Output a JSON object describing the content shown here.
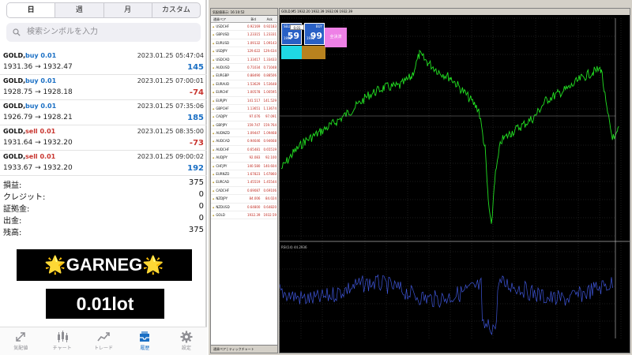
{
  "period_tabs": [
    "日",
    "週",
    "月",
    "カスタム"
  ],
  "search": {
    "placeholder": "検索シンボルを入力"
  },
  "trades": [
    {
      "symbol": "GOLD,",
      "side": "buy 0.01",
      "time": "2023.01.25 05:47:04",
      "prices": "1931.36 → 1932.47",
      "profit": "145"
    },
    {
      "symbol": "GOLD,",
      "side": "buy 0.01",
      "time": "2023.01.25 07:00:01",
      "prices": "1928.75 → 1928.18",
      "profit": "-74"
    },
    {
      "symbol": "GOLD,",
      "side": "buy 0.01",
      "time": "2023.01.25 07:35:06",
      "prices": "1926.79 → 1928.21",
      "profit": "185"
    },
    {
      "symbol": "GOLD,",
      "side": "sell 0.01",
      "time": "2023.01.25 08:35:00",
      "prices": "1931.64 → 1932.20",
      "profit": "-73"
    },
    {
      "symbol": "GOLD,",
      "side": "sell 0.01",
      "time": "2023.01.25 09:00:02",
      "prices": "1933.67 → 1932.20",
      "profit": "192"
    }
  ],
  "summary": [
    {
      "label": "損益:",
      "value": "375"
    },
    {
      "label": "クレジット:",
      "value": "0"
    },
    {
      "label": "証拠金:",
      "value": "0"
    },
    {
      "label": "出金:",
      "value": "0"
    },
    {
      "label": "残高:",
      "value": "375"
    }
  ],
  "promo": {
    "name": "GARNEG",
    "star": "🌟",
    "lot": "0.01lot"
  },
  "bottom_nav": [
    {
      "label": "気配値",
      "icon": "quotes-icon",
      "active": false
    },
    {
      "label": "チャート",
      "icon": "chart-icon",
      "active": false
    },
    {
      "label": "トレード",
      "icon": "trade-icon",
      "active": false
    },
    {
      "label": "履歴",
      "icon": "history-icon",
      "active": true
    },
    {
      "label": "設定",
      "icon": "settings-icon",
      "active": false
    }
  ],
  "mt4": {
    "market_watch_title": "気配値表示: 16:10:52",
    "columns": [
      "通貨ペア",
      "Bid",
      "Ask"
    ],
    "symbols": [
      {
        "sym": "USDCHF",
        "bid": "0.92169",
        "ask": "0.92183"
      },
      {
        "sym": "GBPUSD",
        "bid": "1.23315",
        "ask": "1.23331"
      },
      {
        "sym": "EURUSD",
        "bid": "1.09132",
        "ask": "1.09143"
      },
      {
        "sym": "USDJPY",
        "bid": "129.622",
        "ask": "129.634"
      },
      {
        "sym": "USDCAD",
        "bid": "1.33417",
        "ask": "1.33433"
      },
      {
        "sym": "AUDUSD",
        "bid": "0.71034",
        "ask": "0.71048"
      },
      {
        "sym": "EURGBP",
        "bid": "0.88490",
        "ask": "0.88506"
      },
      {
        "sym": "EURAUD",
        "bid": "1.53629",
        "ask": "1.53648"
      },
      {
        "sym": "EURCHF",
        "bid": "1.00578",
        "ask": "1.00595"
      },
      {
        "sym": "EURJPY",
        "bid": "141.517",
        "ask": "141.529"
      },
      {
        "sym": "GBPCHF",
        "bid": "1.13651",
        "ask": "1.13674"
      },
      {
        "sym": "CADJPY",
        "bid": "97.076",
        "ask": "97.091"
      },
      {
        "sym": "GBPJPY",
        "bid": "159.747",
        "ask": "159.764"
      },
      {
        "sym": "AUDNZD",
        "bid": "1.09447",
        "ask": "1.09468"
      },
      {
        "sym": "AUDCAD",
        "bid": "0.94646",
        "ask": "0.94668"
      },
      {
        "sym": "AUDCHF",
        "bid": "0.65481",
        "ask": "0.65519"
      },
      {
        "sym": "AUDJPY",
        "bid": "92.083",
        "ask": "92.100"
      },
      {
        "sym": "CHFJPY",
        "bid": "140.580",
        "ask": "140.604"
      },
      {
        "sym": "EURNZD",
        "bid": "1.67823",
        "ask": "1.67860"
      },
      {
        "sym": "EURCAD",
        "bid": "1.45519",
        "ask": "1.45544"
      },
      {
        "sym": "CADCHF",
        "bid": "0.69087",
        "ask": "0.69106"
      },
      {
        "sym": "NZDJPY",
        "bid": "84.006",
        "ask": "84.024"
      },
      {
        "sym": "NZDUSD",
        "bid": "0.64800",
        "ask": "0.64820"
      },
      {
        "sym": "GOLD",
        "bid": "1932.39",
        "ask": "1932.59"
      }
    ],
    "tabs_bottom": "通貨ペア | ティックチャート",
    "chart_title": "GOLD,M5 1932.20 1932.39 1932.06 1932.39",
    "panel": {
      "sell_label": "SELL",
      "buy_label": "BUY",
      "lot": "0.01",
      "sell_big": "59",
      "sell_small": "1932",
      "buy_big": "99",
      "buy_small": "1932",
      "close_all": "全決済"
    },
    "indicator_label": "RSI(14) 44.2936"
  }
}
